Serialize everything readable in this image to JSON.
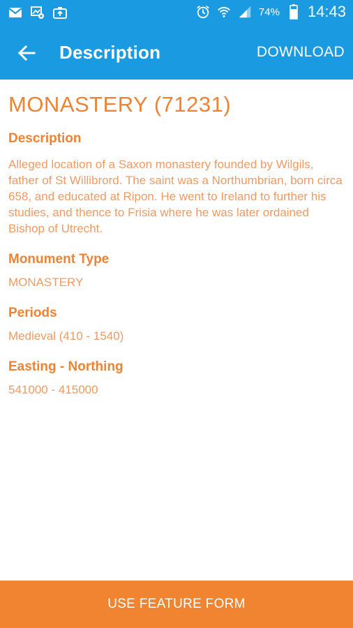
{
  "status_bar": {
    "battery_percent": "74%",
    "time": "14:43",
    "left_icons": [
      "gmail-icon",
      "image-notification-icon",
      "camera-upload-icon"
    ],
    "right_icons": [
      "alarm-icon",
      "wifi-icon",
      "signal-icon",
      "battery-icon"
    ]
  },
  "app_bar": {
    "title": "Description",
    "action": "DOWNLOAD",
    "back_icon": "back-arrow-icon",
    "color": "#1a9ae0"
  },
  "record": {
    "title": "MONASTERY (71231)",
    "fields": [
      {
        "label": "Description",
        "value": "Alleged location of a Saxon monastery founded by Wilgils, father of St Willibrord. The saint was a Northumbrian, born circa 658, and educated at Ripon. He went to Ireland to further his studies, and thence to Frisia where he was later ordained Bishop of Utrecht."
      },
      {
        "label": "Monument Type",
        "value": "MONASTERY"
      },
      {
        "label": "Periods",
        "value": "Medieval (410 - 1540)"
      },
      {
        "label": "Easting - Northing",
        "value": "541000 - 415000"
      }
    ]
  },
  "bottom_button": {
    "label": "USE FEATURE FORM",
    "color": "#f08430"
  },
  "accent_color": "#ef8233"
}
